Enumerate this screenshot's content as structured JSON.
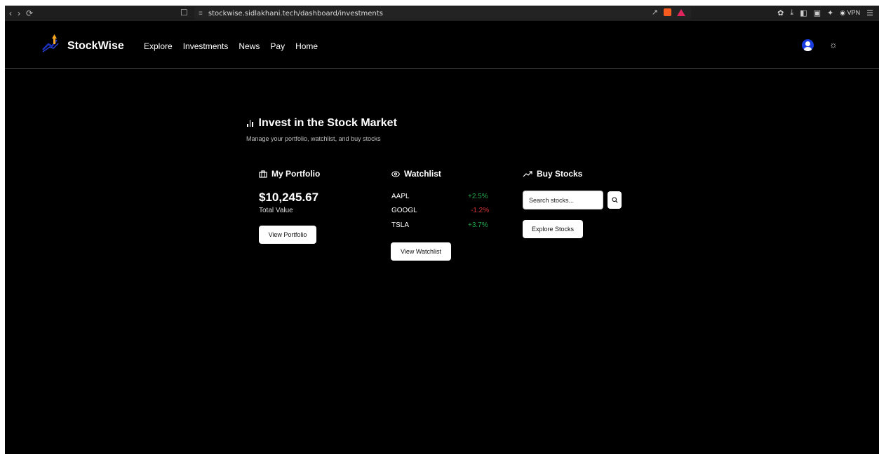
{
  "browser": {
    "url": "stockwise.sidlakhani.tech/dashboard/investments",
    "vpn_label": "VPN"
  },
  "header": {
    "brand": "StockWise",
    "nav": [
      "Explore",
      "Investments",
      "News",
      "Pay",
      "Home"
    ]
  },
  "main": {
    "title": "Invest in the Stock Market",
    "subtitle": "Manage your portfolio, watchlist, and buy stocks"
  },
  "portfolio": {
    "heading": "My Portfolio",
    "total_value": "$10,245.67",
    "total_label": "Total Value",
    "button_label": "View Portfolio"
  },
  "watchlist": {
    "heading": "Watchlist",
    "items": [
      {
        "symbol": "AAPL",
        "change": "+2.5%"
      },
      {
        "symbol": "GOOGL",
        "change": "-1.2%"
      },
      {
        "symbol": "TSLA",
        "change": "+3.7%"
      }
    ],
    "button_label": "View Watchlist"
  },
  "buy": {
    "heading": "Buy Stocks",
    "search_placeholder": "Search stocks...",
    "explore_label": "Explore Stocks"
  },
  "colors": {
    "positive": "#22a84a",
    "negative": "#d83535",
    "avatar": "#1a3de0"
  }
}
